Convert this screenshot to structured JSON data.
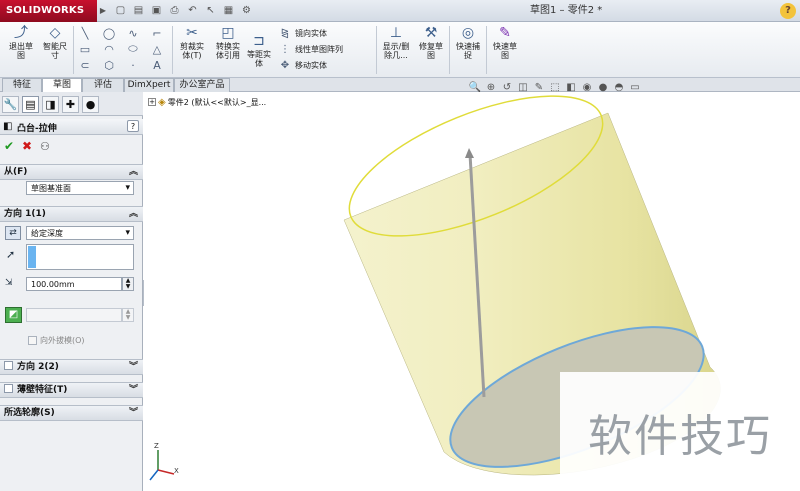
{
  "app": {
    "logo": "SOLIDWORKS",
    "window_title": "草图1 – 零件2 *",
    "help_icon": "help-icon"
  },
  "quick_access": [
    "new-icon",
    "open-icon",
    "save-icon",
    "print-icon",
    "undo-icon",
    "select-icon",
    "rebuild-icon",
    "options-icon"
  ],
  "ribbon": {
    "exit_sketch": "退出草\n图",
    "smart_dim": "智能尺\n寸",
    "trim": "剪裁实\n体(T)",
    "convert": "转换实\n体引用",
    "offset": "等距实\n体",
    "mirror": "镜向实体",
    "linear_pattern": "线性草图阵列",
    "move": "移动实体",
    "display_delete": "显示/删\n除几...",
    "repair": "修复草\n图",
    "quick_snap": "快速捕\n捉",
    "rapid_sketch": "快速草\n图"
  },
  "tabs": [
    {
      "label": "特征",
      "active": false
    },
    {
      "label": "草图",
      "active": true
    },
    {
      "label": "评估",
      "active": false
    },
    {
      "label": "DimXpert",
      "active": false
    },
    {
      "label": "办公室产品",
      "active": false
    }
  ],
  "feature_tree": {
    "root": "零件2  (默认<<默认>_显..."
  },
  "property_manager": {
    "title": "凸台-拉伸",
    "help": "?",
    "from_label": "从(F)",
    "from_value": "草图基准面",
    "dir1_label": "方向 1(1)",
    "end_condition": "给定深度",
    "depth_value": "100.00mm",
    "draft_outward": "向外拔模(O)",
    "dir2_label": "方向 2(2)",
    "thin_label": "薄壁特征(T)",
    "contours_label": "所选轮廓(S)"
  },
  "watermark": "软件技巧",
  "colors": {
    "accent": "#c8102e",
    "body": "#eeeab0",
    "edge_top": "#e0dc3a",
    "edge_bottom": "#6ea8d8"
  }
}
